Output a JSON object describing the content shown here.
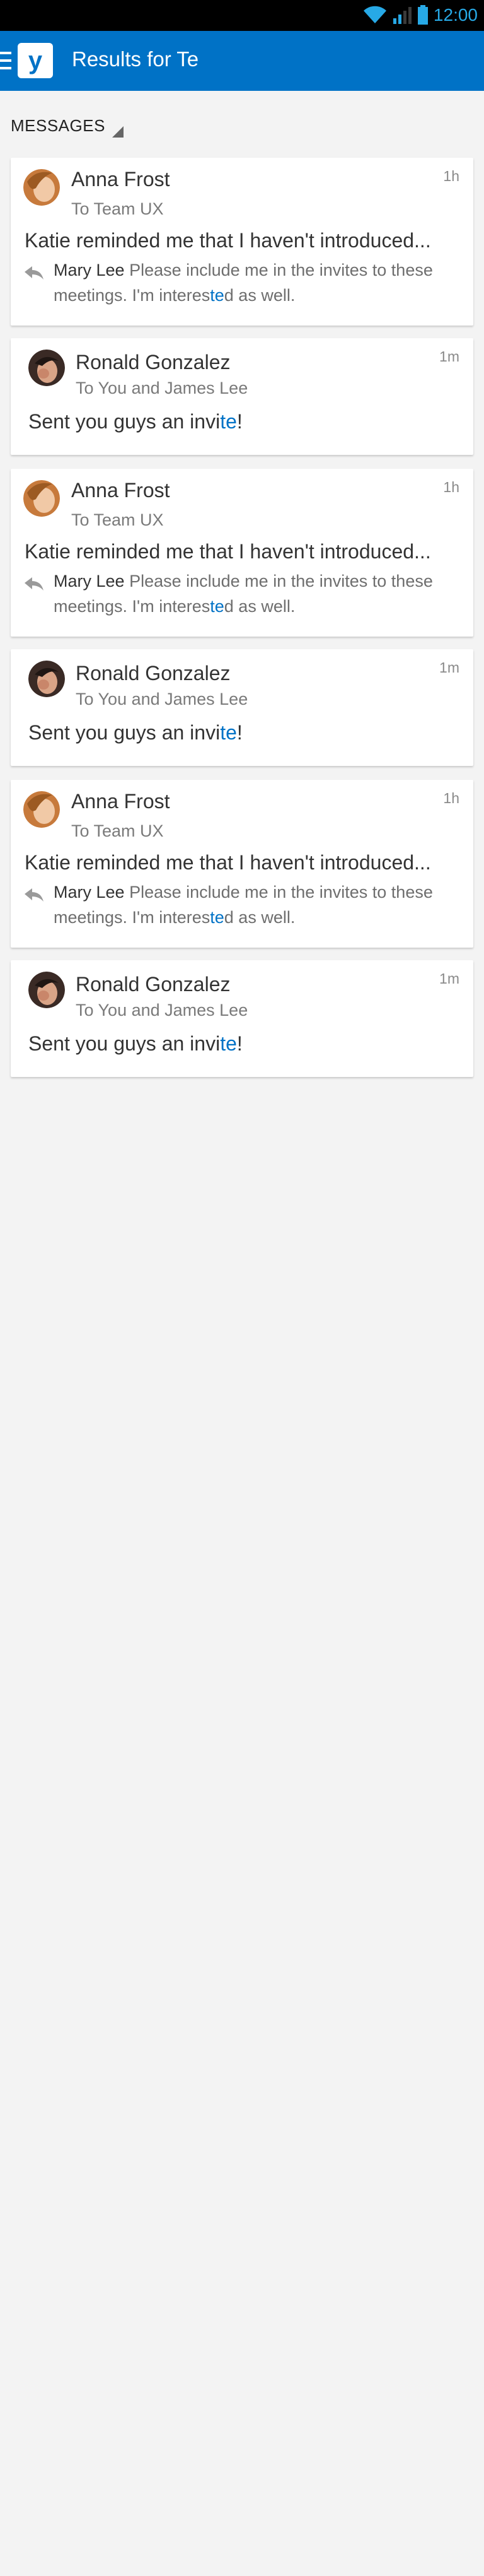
{
  "status_bar": {
    "time": "12:00",
    "icons": [
      "wifi-icon",
      "signal-icon",
      "battery-icon"
    ]
  },
  "app_bar": {
    "logo": "y",
    "title": "Results for Te"
  },
  "section": {
    "label": "MESSAGES"
  },
  "colors": {
    "brand": "#0072c6",
    "status_time": "#27a9e6"
  },
  "messages": [
    {
      "author": "Anna Frost",
      "to": "To Team UX",
      "time": "1h",
      "body": "Katie reminded me that I haven't introduced...",
      "reply_name": "Mary Lee",
      "reply_text_1": " Please include me in the invites to these meetings. I'm interes",
      "reply_highlight": "te",
      "reply_text_2": "d as well."
    },
    {
      "author": "Ronald Gonzalez",
      "to": "To You and James Lee",
      "time": "1m",
      "body_prefix": "Sent you guys an invi",
      "body_highlight": "te",
      "body_suffix": "!"
    },
    {
      "author": "Anna Frost",
      "to": "To Team UX",
      "time": "1h",
      "body": "Katie reminded me that I haven't introduced...",
      "reply_name": "Mary Lee",
      "reply_text_1": " Please include me in the invites to these meetings. I'm interes",
      "reply_highlight": "te",
      "reply_text_2": "d as well."
    },
    {
      "author": "Ronald Gonzalez",
      "to": "To You and James Lee",
      "time": "1m",
      "body_prefix": "Sent you guys an invi",
      "body_highlight": "te",
      "body_suffix": "!"
    },
    {
      "author": "Anna Frost",
      "to": "To Team UX",
      "time": "1h",
      "body": "Katie reminded me that I haven't introduced...",
      "reply_name": "Mary Lee",
      "reply_text_1": " Please include me in the invites to these meetings. I'm interes",
      "reply_highlight": "te",
      "reply_text_2": "d as well."
    },
    {
      "author": "Ronald Gonzalez",
      "to": "To You and James Lee",
      "time": "1m",
      "body_prefix": "Sent you guys an invi",
      "body_highlight": "te",
      "body_suffix": "!"
    }
  ]
}
